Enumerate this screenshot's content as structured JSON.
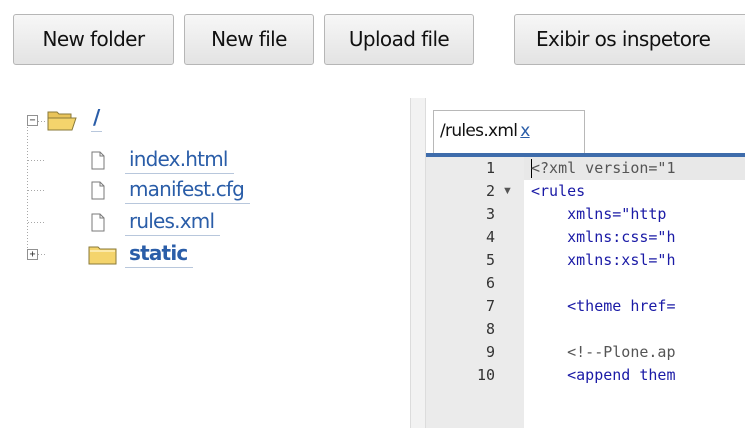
{
  "toolbar": {
    "new_folder_label": "New folder",
    "new_file_label": "New file",
    "upload_file_label": "Upload file",
    "inspectors_label": "Exibir os inspetore"
  },
  "tree": {
    "root": {
      "label": "/"
    },
    "files": [
      {
        "label": "index.html"
      },
      {
        "label": "manifest.cfg"
      },
      {
        "label": "rules.xml"
      }
    ],
    "folders": [
      {
        "label": "static"
      }
    ]
  },
  "editor": {
    "tab": {
      "label": "/rules.xml",
      "close_label": "x"
    },
    "lines": [
      {
        "number": "1",
        "text": "<?xml version=\"1"
      },
      {
        "number": "2",
        "text": "<rules"
      },
      {
        "number": "3",
        "text": "    xmlns=\"http"
      },
      {
        "number": "4",
        "text": "    xmlns:css=\"h"
      },
      {
        "number": "5",
        "text": "    xmlns:xsl=\"h"
      },
      {
        "number": "6",
        "text": ""
      },
      {
        "number": "7",
        "text": "    <theme href="
      },
      {
        "number": "8",
        "text": ""
      },
      {
        "number": "9",
        "text": "    <!--Plone.ap"
      },
      {
        "number": "10",
        "text": "    <append them"
      }
    ]
  },
  "icons": {
    "folder_open": "folder-open-icon",
    "folder": "folder-icon",
    "file": "file-icon",
    "expand": "plus-icon",
    "collapse": "minus-icon",
    "fold": "fold-arrow-icon"
  },
  "colors": {
    "accent": "#3e6cab",
    "link": "#2a5da8",
    "folder_fill": "#f4d46c",
    "gutter": "#ebebeb"
  }
}
